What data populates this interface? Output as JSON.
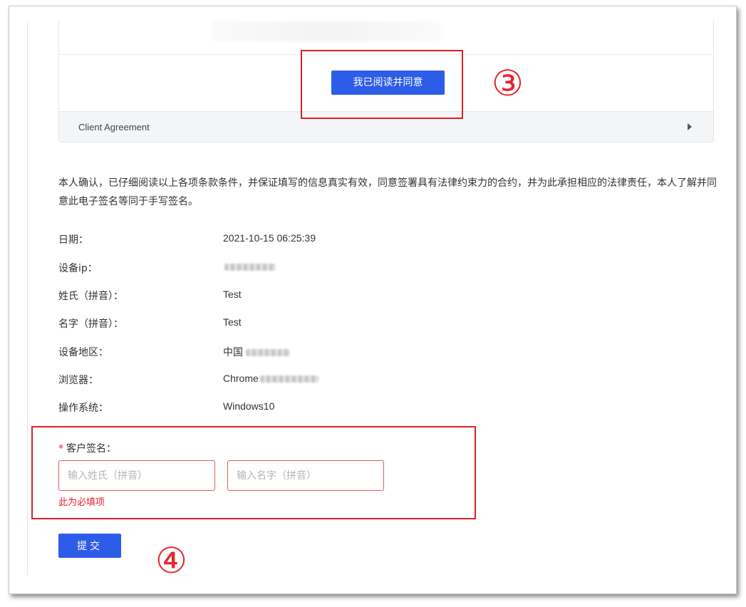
{
  "agreement": {
    "agree_button_label": "我已阅读并同意",
    "client_agreement_label": "Client Agreement"
  },
  "annotations": {
    "step3": "③",
    "step4": "④"
  },
  "declaration": "本人确认，已仔细阅读以上各项条款条件，并保证填写的信息真实有效，同意签署具有法律约束力的合约，并为此承担相应的法律责任，本人了解并同意此电子签名等同于手写签名。",
  "info": {
    "date": {
      "label": "日期：",
      "value": "2021-10-15 06:25:39"
    },
    "device_ip": {
      "label": "设备ip：",
      "value": ""
    },
    "surname": {
      "label": "姓氏（拼音）：",
      "value": "Test"
    },
    "given_name": {
      "label": "名字（拼音）：",
      "value": "Test"
    },
    "region": {
      "label": "设备地区：",
      "value": "中国"
    },
    "browser": {
      "label": "浏览器：",
      "value": "Chrome"
    },
    "os": {
      "label": "操作系统：",
      "value": "Windows10"
    }
  },
  "signature": {
    "required_mark": "*",
    "label": "客户签名：",
    "surname_placeholder": "输入姓氏（拼音）",
    "given_name_placeholder": "输入名字（拼音）",
    "error": "此为必填项"
  },
  "submit_label": "提交",
  "colors": {
    "primary": "#2d5ce8",
    "annotation_red": "#d9202a",
    "error_red": "#e8242f"
  }
}
